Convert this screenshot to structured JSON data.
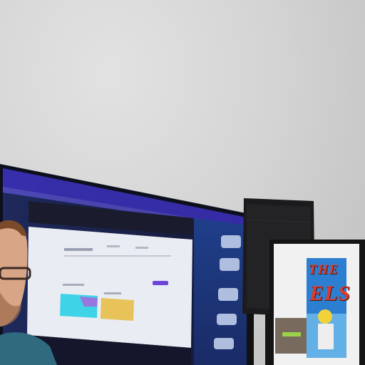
{
  "scene": {
    "description_free": true,
    "poster": {
      "title_line1": "THE",
      "title_line2": "ELS"
    },
    "colors": {
      "wall": "#d4d4d4",
      "screen_frame": "#1b1d3a",
      "screen_glow": "#4b3bd6",
      "slide_bg": "#e9ecf3",
      "card_cyan": "#3fd3e8",
      "card_yellow": "#e8c35a",
      "speaker": "#1a1a1a",
      "poster_bg": "#2c7fd0",
      "shirt": "#2f6a7f"
    }
  }
}
